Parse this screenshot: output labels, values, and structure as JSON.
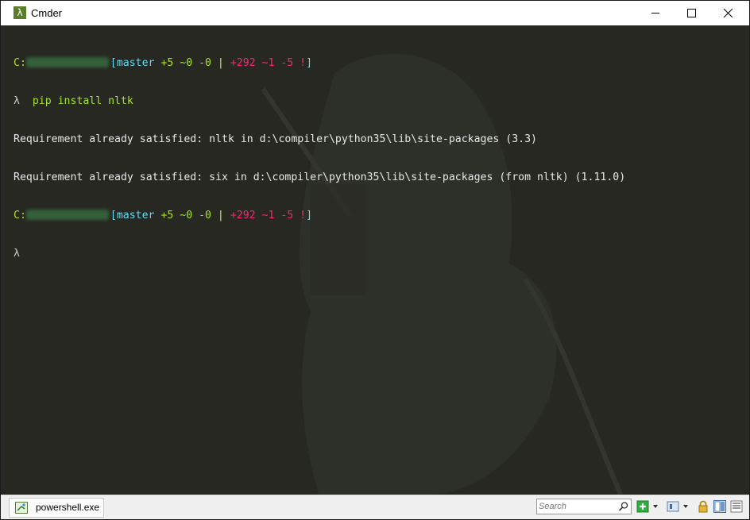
{
  "window": {
    "title": "Cmder",
    "app_icon": "lambda-icon",
    "glyph_lambda": "λ"
  },
  "terminal": {
    "lines": [
      {
        "path": "C:",
        "git_open": "[",
        "branch": "master",
        "staged": "+5 ~0 -0",
        "sep": "|",
        "unstaged": "+292 ~1 -5 !",
        "git_close": "]"
      },
      {
        "prompt": "λ",
        "command": "pip install nltk"
      },
      {
        "output": "Requirement already satisfied: nltk in d:\\compiler\\python35\\lib\\site-packages (3.3)"
      },
      {
        "output": "Requirement already satisfied: six in d:\\compiler\\python35\\lib\\site-packages (from nltk) (1.11.0)"
      },
      {
        "path": "C:",
        "git_open": "[",
        "branch": "master",
        "staged": "+5 ~0 -0",
        "sep": "|",
        "unstaged": "+292 ~1 -5 !",
        "git_close": "]"
      },
      {
        "prompt": "λ"
      }
    ]
  },
  "statusbar": {
    "tab_label": "powershell.exe",
    "search_placeholder": "Search"
  },
  "colors": {
    "terminal_bg": "#272822",
    "path": "#a6e22e",
    "git": "#66d9ef",
    "deleted": "#f92672"
  }
}
